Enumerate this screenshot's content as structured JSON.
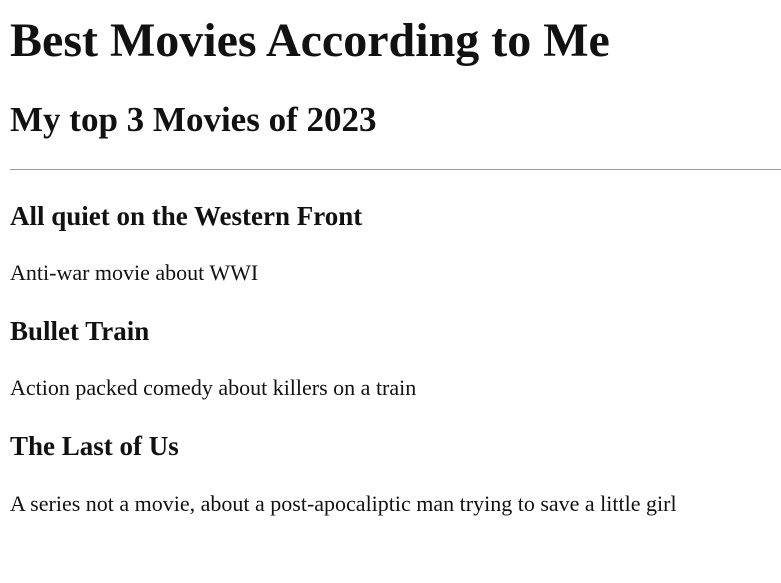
{
  "page": {
    "title": "Best Movies According to Me",
    "subtitle": "My top 3 Movies of 2023"
  },
  "movies": [
    {
      "title": "All quiet on the Western Front",
      "description": "Anti-war movie about WWI"
    },
    {
      "title": "Bullet Train",
      "description": "Action packed comedy about killers on a train"
    },
    {
      "title": "The Last of Us",
      "description": "A series not a movie, about a post-apocaliptic man trying to save a little girl"
    }
  ]
}
